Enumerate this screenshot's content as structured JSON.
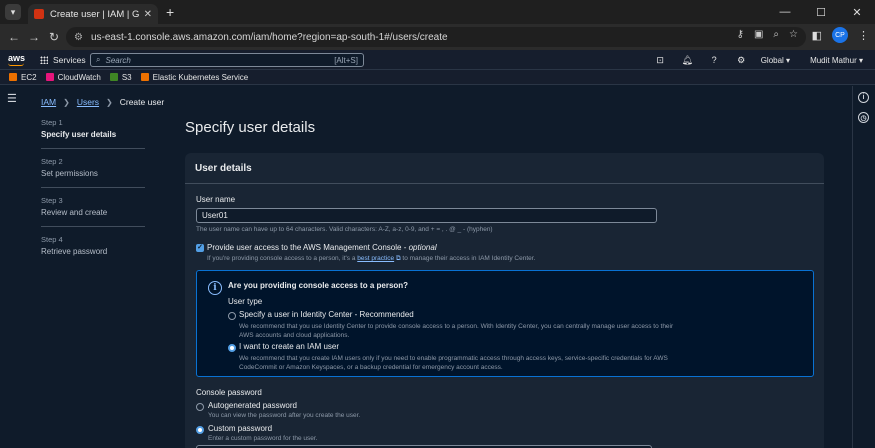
{
  "browser": {
    "tab_title": "Create user | IAM | Global",
    "url": "us-east-1.console.aws.amazon.com/iam/home?region=ap-south-1#/users/create",
    "profile_initials": "CP"
  },
  "aws_header": {
    "logo": "aws",
    "services_label": "Services",
    "search_placeholder": "Search",
    "search_shortcut": "[Alt+S]",
    "region": "Global",
    "user": "Mudit Mathur"
  },
  "favorites": [
    {
      "label": "EC2",
      "color": "#ed7100"
    },
    {
      "label": "CloudWatch",
      "color": "#e7157b"
    },
    {
      "label": "S3",
      "color": "#3f8624"
    },
    {
      "label": "Elastic Kubernetes Service",
      "color": "#ed7100"
    }
  ],
  "breadcrumb": {
    "items": [
      "IAM",
      "Users"
    ],
    "current": "Create user"
  },
  "steps": [
    {
      "num": "Step 1",
      "name": "Specify user details"
    },
    {
      "num": "Step 2",
      "name": "Set permissions"
    },
    {
      "num": "Step 3",
      "name": "Review and create"
    },
    {
      "num": "Step 4",
      "name": "Retrieve password"
    }
  ],
  "page_title": "Specify user details",
  "user_details": {
    "header": "User details",
    "user_name_label": "User name",
    "user_name_value": "User01",
    "user_name_hint": "The user name can have up to 64 characters. Valid characters: A-Z, a-z, 0-9, and + = , . @ _ - (hyphen)",
    "console_access_label": "Provide user access to the AWS Management Console - ",
    "console_access_optional": "optional",
    "console_access_hint_pre": "If you're providing console access to a person, it's a ",
    "console_access_hint_link": "best practice",
    "console_access_hint_post": " to manage their access in IAM Identity Center.",
    "console_access_checked": true
  },
  "info_box": {
    "title": "Are you providing console access to a person?",
    "user_type_label": "User type",
    "options": [
      {
        "label": "Specify a user in Identity Center - Recommended",
        "desc_line1": "We recommend that you use Identity Center to provide console access to a person. With Identity Center, you can centrally manage user access to their",
        "desc_line2": "AWS accounts and cloud applications.",
        "selected": false
      },
      {
        "label": "I want to create an IAM user",
        "desc_line1": "We recommend that you create IAM users only if you need to enable programmatic access through access keys, service-specific credentials for AWS",
        "desc_line2": "CodeCommit or Amazon Keyspaces, or a backup credential for emergency account access.",
        "selected": true
      }
    ]
  },
  "console_password": {
    "label": "Console password",
    "options": [
      {
        "label": "Autogenerated password",
        "desc": "You can view the password after you create the user.",
        "selected": false
      },
      {
        "label": "Custom password",
        "desc": "Enter a custom password for the user.",
        "selected": true
      }
    ]
  }
}
